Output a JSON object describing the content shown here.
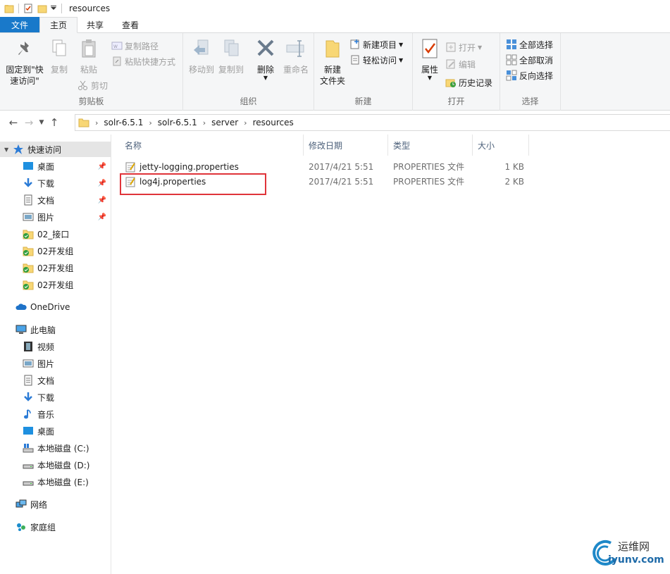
{
  "window": {
    "title": "resources"
  },
  "ribbon_tabs": [
    "文件",
    "主页",
    "共享",
    "查看"
  ],
  "ribbon": {
    "clipboard": {
      "pin_label_1": "固定到\"快",
      "pin_label_2": "速访问\"",
      "copy": "复制",
      "paste": "粘贴",
      "copy_path": "复制路径",
      "paste_shortcut": "粘贴快捷方式",
      "cut": "剪切",
      "group": "剪贴板"
    },
    "organize": {
      "move_to": "移动到",
      "copy_to": "复制到",
      "delete": "删除",
      "rename": "重命名",
      "group": "组织"
    },
    "new": {
      "new_folder_1": "新建",
      "new_folder_2": "文件夹",
      "new_item": "新建项目",
      "easy_access": "轻松访问",
      "group": "新建"
    },
    "open": {
      "properties": "属性",
      "open": "打开",
      "edit": "编辑",
      "history": "历史记录",
      "group": "打开"
    },
    "select": {
      "select_all": "全部选择",
      "select_none": "全部取消",
      "invert": "反向选择",
      "group": "选择"
    }
  },
  "breadcrumb": [
    "solr-6.5.1",
    "solr-6.5.1",
    "server",
    "resources"
  ],
  "sidebar": {
    "quick_access": "快速访问",
    "quick_items": [
      {
        "label": "桌面",
        "icon": "desktop-icon",
        "pinned": true
      },
      {
        "label": "下载",
        "icon": "download-icon",
        "pinned": true
      },
      {
        "label": "文档",
        "icon": "document-icon",
        "pinned": true
      },
      {
        "label": "图片",
        "icon": "picture-icon",
        "pinned": true
      },
      {
        "label": "02_接口",
        "icon": "synced-folder-icon",
        "pinned": false
      },
      {
        "label": "02开发组",
        "icon": "synced-folder-icon",
        "pinned": false
      },
      {
        "label": "02开发组",
        "icon": "synced-folder-icon",
        "pinned": false
      },
      {
        "label": "02开发组",
        "icon": "synced-folder-icon",
        "pinned": false
      }
    ],
    "onedrive": "OneDrive",
    "this_pc": "此电脑",
    "pc_items": [
      {
        "label": "视频",
        "icon": "video-icon"
      },
      {
        "label": "图片",
        "icon": "picture-icon"
      },
      {
        "label": "文档",
        "icon": "document-icon"
      },
      {
        "label": "下载",
        "icon": "download-icon"
      },
      {
        "label": "音乐",
        "icon": "music-icon"
      },
      {
        "label": "桌面",
        "icon": "desktop-icon"
      },
      {
        "label": "本地磁盘 (C:)",
        "icon": "system-drive-icon"
      },
      {
        "label": "本地磁盘 (D:)",
        "icon": "drive-icon"
      },
      {
        "label": "本地磁盘 (E:)",
        "icon": "drive-icon"
      }
    ],
    "network": "网络",
    "homegroup": "家庭组"
  },
  "columns": [
    "名称",
    "修改日期",
    "类型",
    "大小"
  ],
  "files": [
    {
      "name": "jetty-logging.properties",
      "modified": "2017/4/21 5:51",
      "type": "PROPERTIES 文件",
      "size": "1 KB"
    },
    {
      "name": "log4j.properties",
      "modified": "2017/4/21 5:51",
      "type": "PROPERTIES 文件",
      "size": "2 KB"
    }
  ],
  "watermark": {
    "text_cn": "运维网",
    "text_en": "iyunv.com"
  },
  "colors": {
    "accent": "#1979ca",
    "highlight_box": "#e0343a"
  }
}
